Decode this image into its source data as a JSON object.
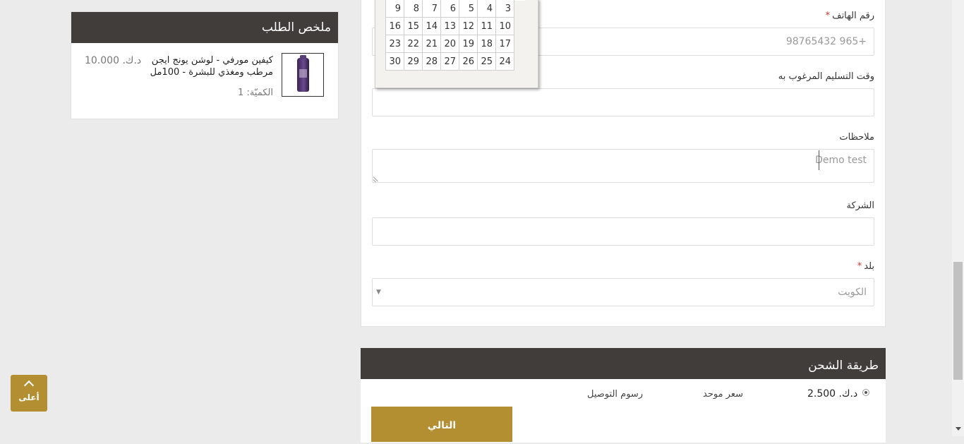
{
  "order_summary": {
    "title": "ملخص الطلب",
    "product": {
      "name": "كيفين مورفي - لوشن يونج ايجن مرطب ومغذي للبشرة - 100مل",
      "price": "د.ك. 10.000",
      "quantity": "الكميّة: 1"
    }
  },
  "calendar": {
    "weeks": [
      [
        "3",
        "4",
        "5",
        "6",
        "7",
        "8",
        "9"
      ],
      [
        "10",
        "11",
        "12",
        "13",
        "14",
        "15",
        "16"
      ],
      [
        "17",
        "18",
        "19",
        "20",
        "21",
        "22",
        "23"
      ],
      [
        "24",
        "25",
        "26",
        "27",
        "28",
        "29",
        "30"
      ]
    ]
  },
  "form": {
    "phone": {
      "label": "رقم الهاتف",
      "required": "*",
      "value": "+965 98765432"
    },
    "delivery_time": {
      "label": "وقت التسليم المرغوب به",
      "value": ""
    },
    "notes": {
      "label": "ملاحظات",
      "value": "Demo test"
    },
    "company": {
      "label": "الشركة",
      "value": ""
    },
    "country": {
      "label": "بلد",
      "required": "*",
      "value": "الكويت"
    }
  },
  "shipping": {
    "title": "طريقة الشحن",
    "option": {
      "price": "د.ك. 2.500",
      "type": "سعر موحد",
      "description": "رسوم التوصيل"
    },
    "next_label": "التالي"
  },
  "back_to_top_label": "أعلى"
}
